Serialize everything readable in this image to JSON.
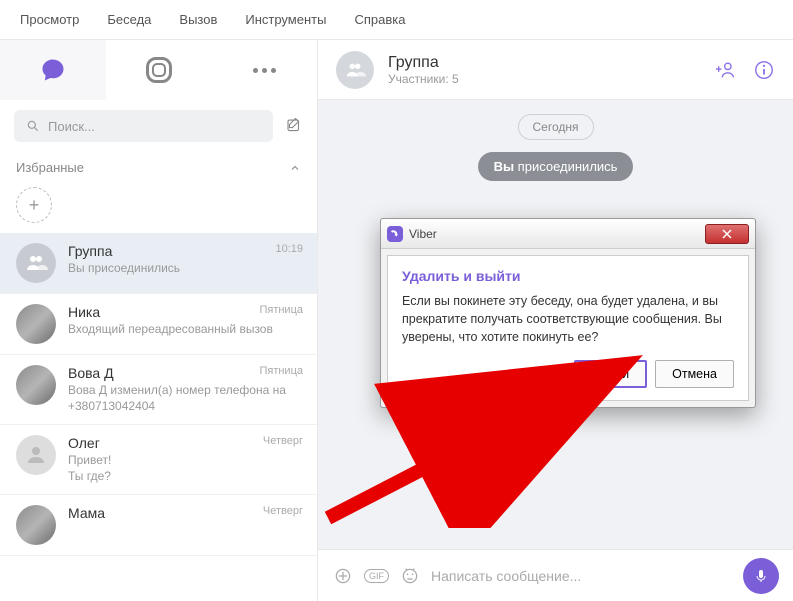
{
  "menubar": [
    "Просмотр",
    "Беседа",
    "Вызов",
    "Инструменты",
    "Справка"
  ],
  "search": {
    "placeholder": "Поиск..."
  },
  "favorites": {
    "header": "Избранные"
  },
  "chats": [
    {
      "name": "Группа",
      "preview": "Вы присоединились",
      "time": "10:19",
      "avatar": "group",
      "selected": true
    },
    {
      "name": "Ника",
      "preview": "Входящий переадресованный вызов",
      "time": "Пятница",
      "avatar": "photo"
    },
    {
      "name": "Вова Д",
      "preview": "Вова Д изменил(а) номер телефона на +380713042404",
      "time": "Пятница",
      "avatar": "photo"
    },
    {
      "name": "Олег",
      "preview": "Привет!\nТы где?",
      "time": "Четверг",
      "avatar": "blank"
    },
    {
      "name": "Мама",
      "preview": "",
      "time": "Четверг",
      "avatar": "photo"
    }
  ],
  "main": {
    "title": "Группа",
    "subtitle": "Участники: 5",
    "datePill": "Сегодня",
    "joinedPrefix": "Вы",
    "joinedRest": " присоединились",
    "inputPlaceholder": "Написать сообщение..."
  },
  "dialog": {
    "appName": "Viber",
    "heading": "Удалить и выйти",
    "text": "Если вы покинете эту беседу, она будет удалена, и вы прекратите получать соответствующие сообщения. Вы уверены, что хотите покинуть ее?",
    "primaryBtn": "Выйти",
    "secondaryBtn": "Отмена"
  }
}
